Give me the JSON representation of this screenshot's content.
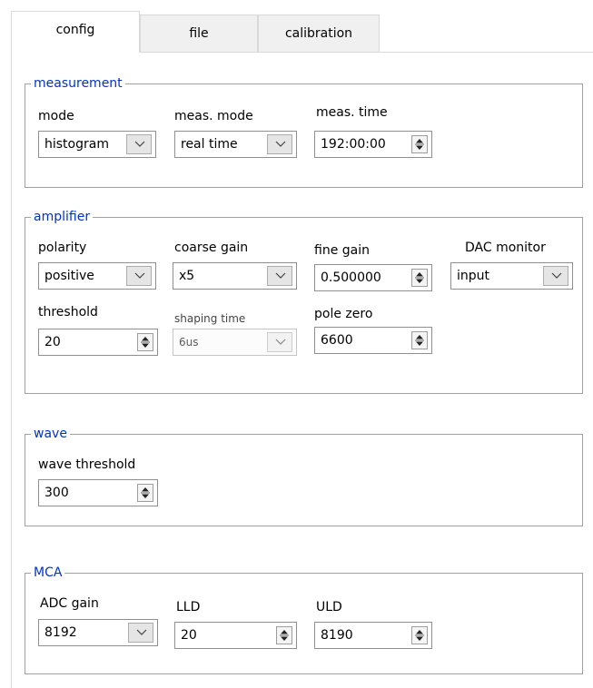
{
  "tabs": [
    {
      "label": "config",
      "active": true
    },
    {
      "label": "file",
      "active": false
    },
    {
      "label": "calibration",
      "active": false
    }
  ],
  "measurement": {
    "title": "measurement",
    "mode": {
      "label": "mode",
      "value": "histogram"
    },
    "meas_mode": {
      "label": "meas. mode",
      "value": "real time"
    },
    "meas_time": {
      "label": "meas. time",
      "value": "192:00:00"
    }
  },
  "amplifier": {
    "title": "amplifier",
    "polarity": {
      "label": "polarity",
      "value": "positive"
    },
    "coarse_gain": {
      "label": "coarse gain",
      "value": "x5"
    },
    "fine_gain": {
      "label": "fine gain",
      "value": "0.500000"
    },
    "dac_monitor": {
      "label": "DAC monitor",
      "value": "input"
    },
    "threshold": {
      "label": "threshold",
      "value": "20"
    },
    "shaping_time": {
      "label": "shaping time",
      "value": "6us",
      "enabled": false
    },
    "pole_zero": {
      "label": "pole zero",
      "value": "6600"
    }
  },
  "wave": {
    "title": "wave",
    "wave_threshold": {
      "label": "wave threshold",
      "value": "300"
    }
  },
  "mca": {
    "title": "MCA",
    "adc_gain": {
      "label": "ADC gain",
      "value": "8192"
    },
    "lld": {
      "label": "LLD",
      "value": "20"
    },
    "uld": {
      "label": "ULD",
      "value": "8190"
    }
  },
  "colors": {
    "group_title": "#0033cc",
    "border": "#a0a0a0",
    "tab_bg": "#f0f0f0"
  }
}
